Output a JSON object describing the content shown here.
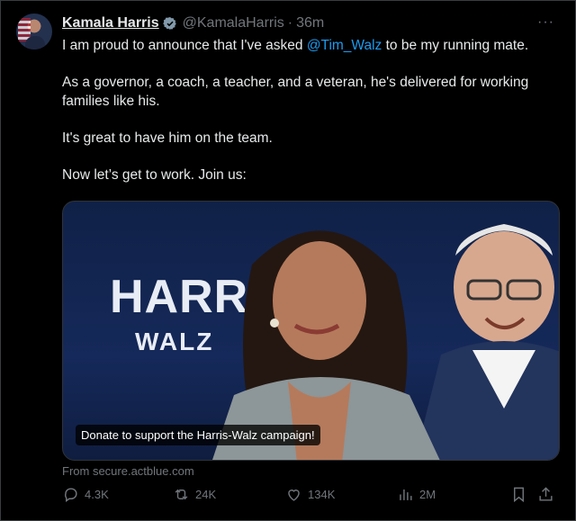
{
  "post": {
    "author_name": "Kamala Harris",
    "handle": "@KamalaHarris",
    "separator": "·",
    "time": "36m",
    "more_label": "···",
    "text_1_before": "I am proud to announce that I've asked ",
    "mention": "@Tim_Walz",
    "text_1_after": " to be my running mate.",
    "text_2": "As a governor, a coach, a teacher, and a veteran, he's delivered for working families like his.",
    "text_3": "It's great to have him on the team.",
    "text_4": "Now let’s get to work. Join us:"
  },
  "card": {
    "headline_1": "HARRIS",
    "headline_2": "WALZ",
    "caption": "Donate to support the Harris-Walz campaign!",
    "source": "From secure.actblue.com"
  },
  "actions": {
    "replies": "4.3K",
    "reposts": "24K",
    "likes": "134K",
    "views": "2M"
  },
  "colors": {
    "accent": "#1d9bf0",
    "muted": "#71767b",
    "background": "#000000"
  },
  "icons": [
    "verified-badge-icon",
    "more-icon",
    "reply-icon",
    "repost-icon",
    "like-icon",
    "views-icon",
    "bookmark-icon",
    "share-icon"
  ]
}
